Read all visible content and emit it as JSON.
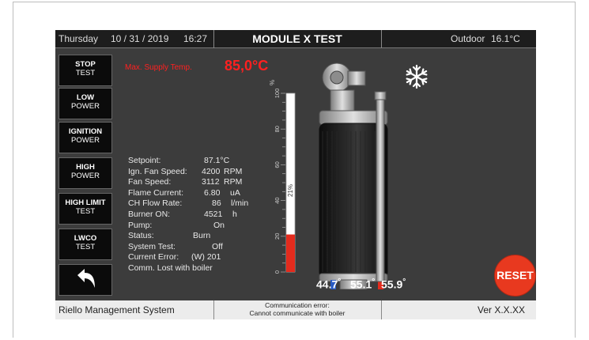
{
  "header": {
    "day": "Thursday",
    "date": "10 / 31 / 2019",
    "time": "16:27",
    "title": "MODULE X TEST",
    "outdoor_label": "Outdoor",
    "outdoor_temp": "16.1°C"
  },
  "sidebar": {
    "buttons": [
      {
        "line1": "STOP",
        "line2": "TEST"
      },
      {
        "line1": "LOW",
        "line2": "POWER"
      },
      {
        "line1": "IGNITION",
        "line2": "POWER"
      },
      {
        "line1": "HIGH",
        "line2": "POWER"
      },
      {
        "line1": "HIGH LIMIT",
        "line2": "TEST"
      },
      {
        "line1": "LWCO",
        "line2": "TEST"
      }
    ],
    "back_icon": "back-arrow-icon"
  },
  "alert": {
    "label": "Max. Supply Temp.",
    "value": "85,0°C",
    "color": "#ff2020"
  },
  "status_icon": "snowflake-icon",
  "params": [
    {
      "label": "Setpoint:",
      "value": "87.1°C",
      "unit": ""
    },
    {
      "label": "Ign. Fan Speed:",
      "value": "4200",
      "unit": "RPM"
    },
    {
      "label": "Fan Speed:",
      "value": "3112",
      "unit": "RPM"
    },
    {
      "label": "Flame Current:",
      "value": "6.80",
      "unit": "uA"
    },
    {
      "label": "CH Flow Rate:",
      "value": "86",
      "unit": "l/min"
    },
    {
      "label": "Burner ON:",
      "value": "4521",
      "unit": "h"
    },
    {
      "label": "Pump:",
      "value": "On",
      "unit": ""
    },
    {
      "label": "Status:",
      "value": "Burn",
      "unit": ""
    },
    {
      "label": "System Test:",
      "value": "Off",
      "unit": ""
    },
    {
      "label": "Current Error:",
      "value": "(W) 201",
      "unit": ""
    },
    {
      "label": "Comm. Lost with boiler",
      "value": "",
      "unit": ""
    }
  ],
  "gauge": {
    "unit_label": "%",
    "ticks": [
      "100",
      "80",
      "60",
      "40",
      "20",
      "0"
    ],
    "level": 21,
    "level_label": "21%",
    "fill_color": "#e32b1d"
  },
  "temperatures": {
    "t1": "44.7",
    "t2": "55.1",
    "t3": "55.9",
    "degree": "°"
  },
  "reset_label": "RESET",
  "footer": {
    "system_name": "Riello Management System",
    "comm_error_line1": "Communication error:",
    "comm_error_line2": "Cannot communicate with boiler",
    "version": "Ver X.X.XX"
  }
}
